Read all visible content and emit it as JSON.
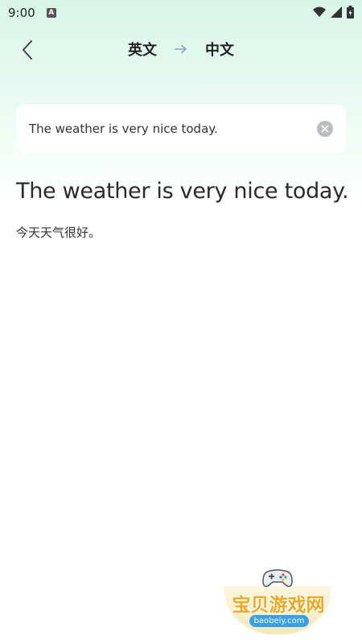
{
  "status_bar": {
    "time": "9:00",
    "app_icon_letter": "A",
    "icons": [
      "wifi-icon",
      "signal-icon",
      "battery-icon"
    ]
  },
  "header": {
    "source_lang": "英文",
    "target_lang": "中文",
    "back_icon": "chevron-left-icon",
    "arrow_icon": "arrow-right-icon"
  },
  "input": {
    "value": "The weather is very nice today.",
    "clear_icon": "clear-icon"
  },
  "translation": {
    "source": "The weather is very nice today.",
    "result": "今天天气很好。"
  },
  "watermark": {
    "title": "宝贝游戏网",
    "url": "baobeiy.com"
  },
  "colors": {
    "header_gradient_top": "#d8f5e8",
    "card_bg": "#ffffff",
    "arrow_color": "#8fa0c8",
    "watermark_orange": "#f2a81d",
    "watermark_blue": "#3aa0e6"
  }
}
